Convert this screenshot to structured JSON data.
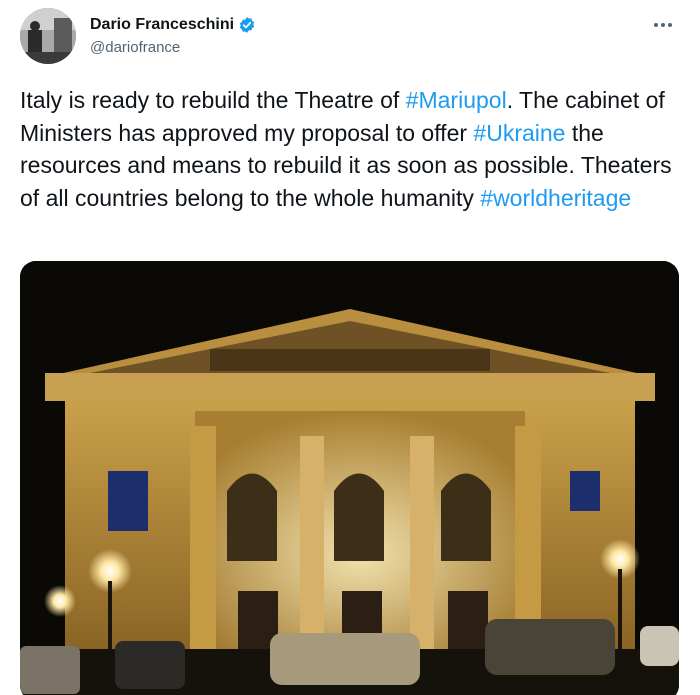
{
  "tweet": {
    "author": {
      "display_name": "Dario Franceschini",
      "handle": "@dariofrance",
      "verified": true,
      "avatar_icon": "profile-photo-icon"
    },
    "more_options_icon": "ellipsis-icon",
    "text_segments": [
      {
        "text": "Italy is ready to rebuild the Theatre of ",
        "type": "text"
      },
      {
        "text": "#Mariupol",
        "type": "hashtag"
      },
      {
        "text": ". The cabinet of Ministers has approved my proposal to offer ",
        "type": "text"
      },
      {
        "text": "#Ukraine",
        "type": "hashtag"
      },
      {
        "text": " the resources and means to  rebuild it as soon as possible. Theaters of all countries belong to the whole humanity ",
        "type": "text"
      },
      {
        "text": "#worldheritage",
        "type": "hashtag"
      }
    ],
    "media": {
      "kind": "photo",
      "subject": "theatre-building-night-photo"
    }
  },
  "colors": {
    "text": "#0f1419",
    "secondary_text": "#536471",
    "hashtag": "#1d9bf0",
    "verified_badge": "#1d9bf0",
    "background": "#ffffff"
  }
}
